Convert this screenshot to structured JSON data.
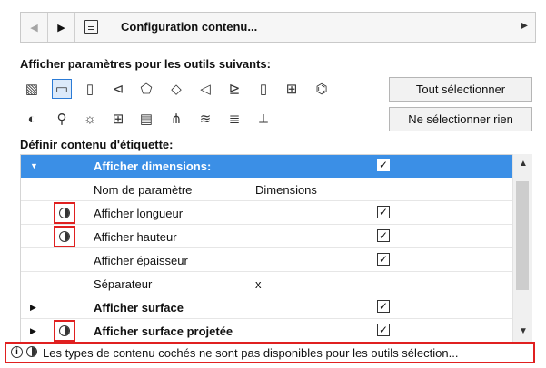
{
  "nav": {
    "back_icon": "chevron-left-icon",
    "forward_icon": "chevron-right-icon",
    "config_label": "Configuration contenu...",
    "dropdown_icon": "chevron-right-icon"
  },
  "tools_section": {
    "title": "Afficher paramètres pour les outils suivants:",
    "select_all_label": "Tout sélectionner",
    "select_none_label": "Ne sélectionner rien",
    "row1_tools": [
      {
        "name": "wall-tool-icon",
        "glyph": "▧"
      },
      {
        "name": "slab-tool-icon",
        "glyph": "▭",
        "selected": true
      },
      {
        "name": "column-tool-icon",
        "glyph": "▯"
      },
      {
        "name": "beam-tool-icon",
        "glyph": "⊲"
      },
      {
        "name": "roof-tool-icon",
        "glyph": "⬠"
      },
      {
        "name": "shell-tool-icon",
        "glyph": "◇"
      },
      {
        "name": "mesh-tool-icon",
        "glyph": "◁"
      },
      {
        "name": "stair-tool-icon",
        "glyph": "⊵"
      },
      {
        "name": "door-tool-icon",
        "glyph": "▯"
      },
      {
        "name": "window-tool-icon",
        "glyph": "⊞"
      },
      {
        "name": "skylight-tool-icon",
        "glyph": "⌬"
      }
    ],
    "row2_tools": [
      {
        "name": "morph-tool-icon",
        "glyph": "◐"
      },
      {
        "name": "object-tool-icon",
        "glyph": "⚲"
      },
      {
        "name": "lamp-tool-icon",
        "glyph": "☼"
      },
      {
        "name": "curtain-wall-tool-icon",
        "glyph": "⊞"
      },
      {
        "name": "panel-tool-icon",
        "glyph": "▤"
      },
      {
        "name": "railing-tool-icon",
        "glyph": "⋔"
      },
      {
        "name": "stair-flight-tool-icon",
        "glyph": "≋"
      },
      {
        "name": "riser-tool-icon",
        "glyph": "≣"
      },
      {
        "name": "handrail-tool-icon",
        "glyph": "⟂"
      }
    ]
  },
  "content_section": {
    "title": "Définir contenu d'étiquette:",
    "rows": [
      {
        "type": "header",
        "label": "Afficher dimensions:",
        "checked": true
      },
      {
        "type": "param",
        "label": "Nom de paramètre",
        "value": "Dimensions"
      },
      {
        "type": "check",
        "label": "Afficher longueur",
        "checked": true,
        "unavailable": true
      },
      {
        "type": "check",
        "label": "Afficher hauteur",
        "checked": true,
        "unavailable": true
      },
      {
        "type": "check",
        "label": "Afficher épaisseur",
        "checked": true
      },
      {
        "type": "param",
        "label": "Séparateur",
        "value": "x"
      },
      {
        "type": "group",
        "label": "Afficher surface",
        "checked": true
      },
      {
        "type": "group",
        "label": "Afficher surface projetée",
        "checked": true,
        "unavailable": true
      }
    ],
    "check_mark": "✓"
  },
  "status_bar": {
    "text": "Les types de contenu cochés ne sont pas disponibles pour les outils sélection...",
    "info_icon_glyph": "i"
  }
}
